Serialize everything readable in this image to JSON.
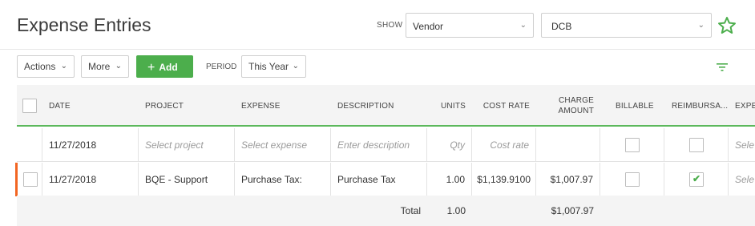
{
  "header": {
    "title": "Expense Entries",
    "show_label": "SHOW",
    "show_select": "Vendor",
    "vendor_select": "DCB",
    "star_icon": "star-outline-icon",
    "accent": "#4cae4c"
  },
  "toolbar": {
    "actions_label": "Actions",
    "more_label": "More",
    "add_label": "Add",
    "period_label": "PERIOD",
    "period_select": "This Year",
    "filter_icon": "filter-icon"
  },
  "columns": {
    "date": "DATE",
    "project": "PROJECT",
    "expense": "EXPENSE",
    "description": "DESCRIPTION",
    "units": "UNITS",
    "cost_rate": "COST RATE",
    "charge_amount_1": "CHARGE",
    "charge_amount_2": "AMOUNT",
    "billable": "BILLABLE",
    "reimbursable": "REIMBURSA...",
    "expense_type": "EXPE"
  },
  "new_entry_row": {
    "date": "11/27/2018",
    "project_placeholder": "Select project",
    "expense_placeholder": "Select expense",
    "description_placeholder": "Enter description",
    "units_placeholder": "Qty",
    "cost_rate_placeholder": "Cost rate",
    "overflow_placeholder": "Sele"
  },
  "rows": [
    {
      "date": "11/27/2018",
      "project": "BQE - Support",
      "expense": "Purchase Tax:",
      "description": "Purchase Tax",
      "units": "1.00",
      "cost_rate": "$1,139.9100",
      "charge_amount": "$1,007.97",
      "billable": false,
      "reimbursable": true,
      "overflow": "Sele"
    }
  ],
  "totals": {
    "label": "Total",
    "units": "1.00",
    "charge_amount": "$1,007.97"
  }
}
